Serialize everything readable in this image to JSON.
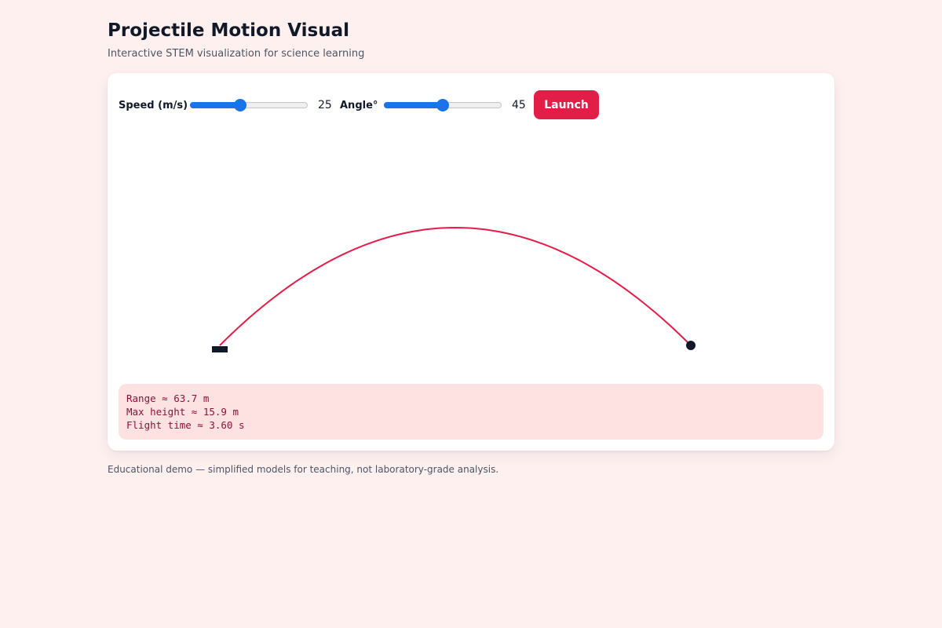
{
  "header": {
    "title": "Projectile Motion Visual",
    "subtitle": "Interactive STEM visualization for science learning"
  },
  "controls": {
    "speed": {
      "label": "Speed (m/s)",
      "value": 25,
      "min": 0,
      "max": 60
    },
    "angle": {
      "label": "Angle°",
      "value": 45,
      "min": 0,
      "max": 90
    },
    "launch_label": "Launch"
  },
  "colors": {
    "accent": "#e11d48",
    "slider": "#1a73e8",
    "trajectory": "#e11d48",
    "projectile": "#111827",
    "stats_bg": "#fee2e2",
    "stats_text": "#881337",
    "page_bg": "#fff0f0"
  },
  "simulation": {
    "gravity": 9.81
  },
  "stats": {
    "range": "Range ≈ 63.7 m",
    "max_height": "Max height ≈ 15.9 m",
    "flight_time": "Flight time ≈ 3.60 s"
  },
  "footer": {
    "note": "Educational demo — simplified models for teaching, not laboratory-grade analysis."
  }
}
